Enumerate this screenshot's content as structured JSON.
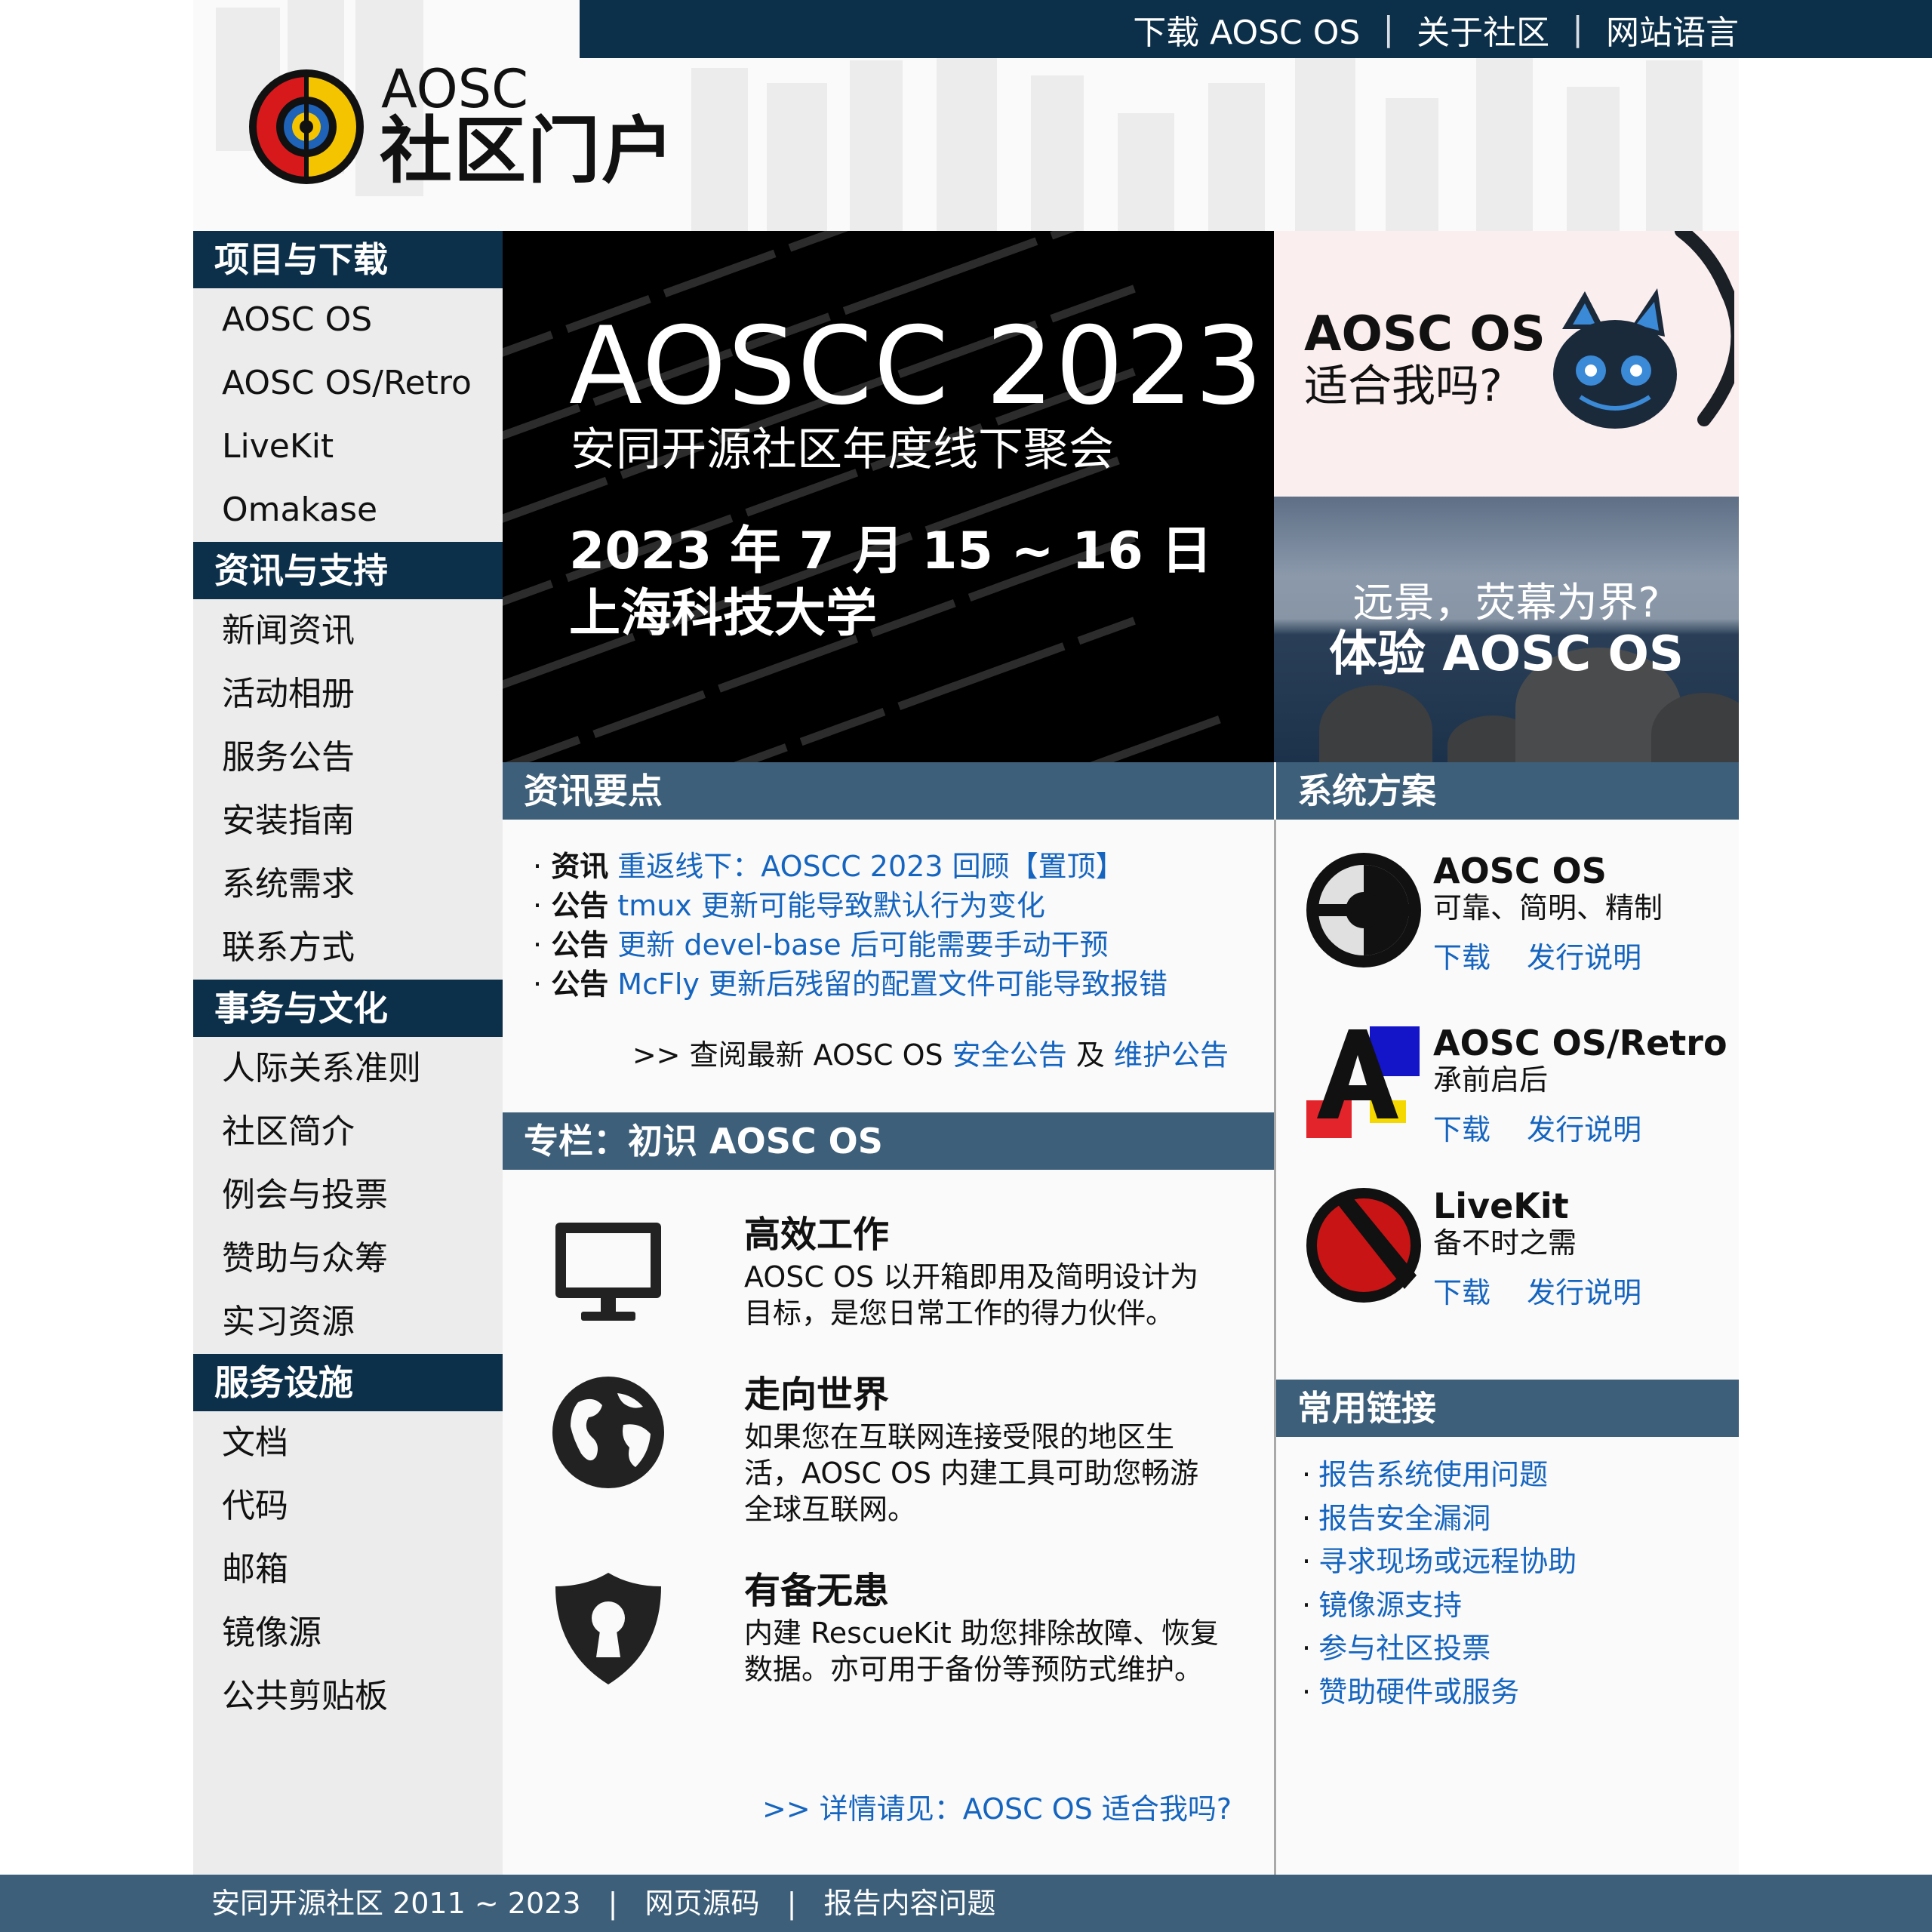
{
  "topnav": {
    "items": [
      "下载 AOSC OS",
      "关于社区",
      "网站语言"
    ],
    "separator": "|"
  },
  "brand": {
    "small": "AOSC",
    "title": "社区门户",
    "logo_icon": "aosc-logo-icon",
    "colors": {
      "red": "#d7191c",
      "yellow": "#f5c400",
      "blue": "#1e63b8",
      "navy": "#0d304a"
    }
  },
  "sidebar": {
    "sections": [
      {
        "title": "项目与下载",
        "items": [
          "AOSC OS",
          "AOSC OS/Retro",
          "LiveKit",
          "Omakase"
        ]
      },
      {
        "title": "资讯与支持",
        "items": [
          "新闻资讯",
          "活动相册",
          "服务公告",
          "安装指南",
          "系统需求",
          "联系方式"
        ]
      },
      {
        "title": "事务与文化",
        "items": [
          "人际关系准则",
          "社区简介",
          "例会与投票",
          "赞助与众筹",
          "实习资源"
        ]
      },
      {
        "title": "服务设施",
        "items": [
          "文档",
          "代码",
          "邮箱",
          "镜像源",
          "公共剪贴板"
        ]
      }
    ]
  },
  "banner": {
    "title": "AOSCC 2023",
    "subtitle": "安同开源社区年度线下聚会",
    "date": "2023 年 7 月 15 ~ 16 日",
    "place": "上海科技大学"
  },
  "promo_fit": {
    "line1": "AOSC OS",
    "line2": "适合我吗?",
    "mascot_icon": "cat-mascot-icon"
  },
  "promo_try": {
    "question": "远景，荧幕为界?",
    "cta": "体验 AOSC OS"
  },
  "news": {
    "header": "资讯要点",
    "items": [
      {
        "tag": "资讯",
        "text": "重返线下：AOSCC 2023 回顾【置顶】"
      },
      {
        "tag": "公告",
        "text": "tmux 更新可能导致默认行为变化"
      },
      {
        "tag": "公告",
        "text": "更新 devel-base 后可能需要手动干预"
      },
      {
        "tag": "公告",
        "text": "McFly 更新后残留的配置文件可能导致报错"
      }
    ],
    "bullet": "·",
    "more_prefix": ">> 查阅最新 AOSC OS",
    "more_link1": "安全公告",
    "more_mid": "及",
    "more_link2": "维护公告"
  },
  "column": {
    "header": "专栏：初识 AOSC OS",
    "features": [
      {
        "icon": "monitor-icon",
        "title": "高效工作",
        "desc": "AOSC OS 以开箱即用及简明设计为目标，是您日常工作的得力伙伴。"
      },
      {
        "icon": "globe-icon",
        "title": "走向世界",
        "desc": "如果您在互联网连接受限的地区生活，AOSC OS 内建工具可助您畅游全球互联网。"
      },
      {
        "icon": "shield-keyhole-icon",
        "title": "有备无患",
        "desc": "内建 RescueKit 助您排除故障、恢复数据。亦可用于备份等预防式维护。"
      }
    ],
    "more": ">> 详情请见：AOSC OS 适合我吗?"
  },
  "systems": {
    "header": "系统方案",
    "items": [
      {
        "icon": "aosc-os-icon",
        "name": "AOSC OS",
        "desc": "可靠、简明、精制",
        "download": "下载",
        "notes": "发行说明"
      },
      {
        "icon": "retro-icon",
        "name": "AOSC OS/Retro",
        "desc": "承前启后",
        "download": "下载",
        "notes": "发行说明"
      },
      {
        "icon": "livekit-icon",
        "name": "LiveKit",
        "desc": "备不时之需",
        "download": "下载",
        "notes": "发行说明"
      }
    ]
  },
  "links": {
    "header": "常用链接",
    "bullet": "·",
    "items": [
      "报告系统使用问题",
      "报告安全漏洞",
      "寻求现场或远程协助",
      "镜像源支持",
      "参与社区投票",
      "赞助硬件或服务"
    ]
  },
  "footer": {
    "copyright": "安同开源社区  2011 ~ 2023",
    "source": "网页源码",
    "report": "报告内容问题",
    "separator": "|"
  }
}
